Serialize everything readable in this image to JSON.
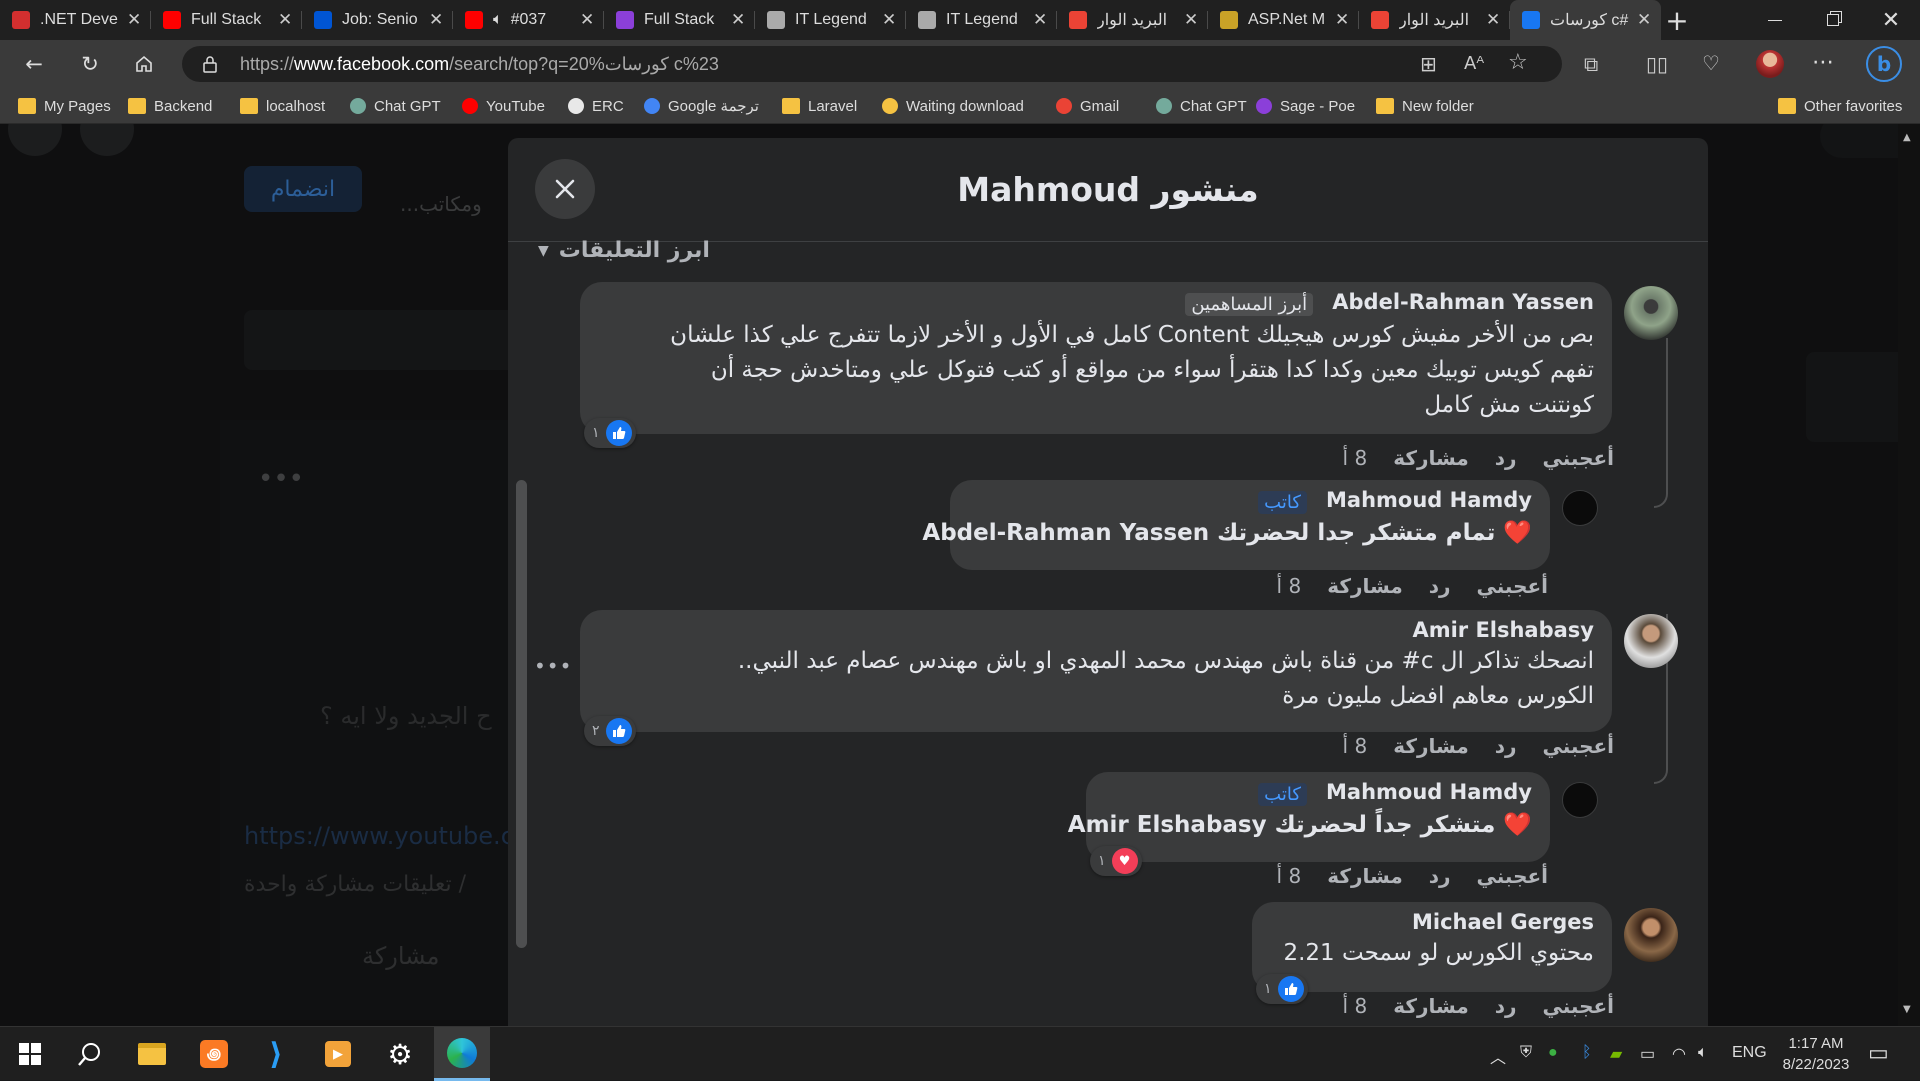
{
  "browser": {
    "tabs": [
      {
        "title": ".NET Deve",
        "icon": "pdf-icon",
        "color": "#d32f2f"
      },
      {
        "title": "Full Stack",
        "icon": "youtube-icon",
        "color": "#ff0000"
      },
      {
        "title": "Job: Senio",
        "icon": "wuzzuf-icon",
        "color": "#0055d4"
      },
      {
        "title": "#037",
        "icon": "youtube-icon",
        "color": "#ff0000",
        "audio": true
      },
      {
        "title": "Full Stack",
        "icon": "poe-icon",
        "color": "#8b3fd9"
      },
      {
        "title": "IT Legend",
        "icon": "page-icon",
        "color": "#aaaaaa"
      },
      {
        "title": "IT Legend",
        "icon": "page-icon",
        "color": "#aaaaaa"
      },
      {
        "title": "البريد الوار",
        "icon": "gmail-icon",
        "color": "#ea4335"
      },
      {
        "title": "ASP.Net M",
        "icon": "pin-icon",
        "color": "#c9a227"
      },
      {
        "title": "البريد الوار",
        "icon": "gmail-icon",
        "color": "#ea4335"
      },
      {
        "title": "كورسات c#",
        "icon": "facebook-icon",
        "color": "#1877f2",
        "active": true
      }
    ],
    "new_tab": "+",
    "url_prefix": "https://",
    "url_host": "www.facebook.com",
    "url_path": "/search/top?q=20%كورسات c%23",
    "bookmarks": [
      {
        "label": "My Pages",
        "icon": "folder-icon"
      },
      {
        "label": "Backend",
        "icon": "folder-icon"
      },
      {
        "label": "localhost",
        "icon": "folder-icon"
      },
      {
        "label": "Chat GPT",
        "icon": "chatgpt-icon"
      },
      {
        "label": "YouTube",
        "icon": "youtube-icon"
      },
      {
        "label": "ERC",
        "icon": "erc-icon"
      },
      {
        "label": "Google ترجمة",
        "icon": "translate-icon"
      },
      {
        "label": "Laravel",
        "icon": "folder-icon"
      },
      {
        "label": "Waiting download",
        "icon": "download-icon"
      },
      {
        "label": "Gmail",
        "icon": "gmail-icon"
      },
      {
        "label": "Chat GPT",
        "icon": "chatgpt-icon"
      },
      {
        "label": "Sage - Poe",
        "icon": "poe-icon"
      },
      {
        "label": "New folder",
        "icon": "folder-icon"
      }
    ],
    "other_favorites": "Other favorites"
  },
  "background_page": {
    "join_button": "انضمام",
    "snippet": "ومكاتب...",
    "question": "ح الجديد ولا ايه ؟",
    "link": "https://www.youtube.co",
    "stats": "/ تعليقات  مشاركة واحدة",
    "share": "مشاركة"
  },
  "modal": {
    "title": "منشور Mahmoud",
    "sort_label": "ابرز التعليقات",
    "comments": [
      {
        "author": "Abdel-Rahman Yassen",
        "badge": "أبرز المساهمين",
        "lines": [
          "بص من الأخر مفيش كورس هيجيلك Content كامل في الأول و الأخر لازما تتفرج علي كذا علشان",
          "تفهم كويس توبيك معين وكدا كدا هتقرأ سواء من مواقع أو كتب فتوكل علي ومتاخدش حجة أن",
          "كونتنت مش كامل"
        ],
        "reaction_count": "١",
        "like": "أعجبني",
        "reply": "رد",
        "share": "مشاركة",
        "time": "8 أ"
      },
      {
        "author": "Mahmoud Hamdy",
        "badge": "كاتب",
        "lines": [
          "❤️ تمام متشكر جدا لحضرتك Abdel-Rahman Yassen"
        ],
        "like": "أعجبني",
        "reply": "رد",
        "share": "مشاركة",
        "time": "8 أ"
      },
      {
        "author": "Amir Elshabasy",
        "lines": [
          "انصحك تذاكر ال c# من قناة باش مهندس محمد المهدي او باش مهندس عصام عبد النبي..",
          "الكورس معاهم افضل مليون مرة"
        ],
        "reaction_count": "٢",
        "like": "أعجبني",
        "reply": "رد",
        "share": "مشاركة",
        "time": "8 أ"
      },
      {
        "author": "Mahmoud Hamdy",
        "badge": "كاتب",
        "lines": [
          "❤️ متشكر جداً لحضرتك Amir Elshabasy"
        ],
        "reaction_count": "١",
        "like": "أعجبني",
        "reply": "رد",
        "share": "مشاركة",
        "time": "8 أ"
      },
      {
        "author": "Michael Gerges",
        "lines": [
          "محتوي الكورس لو سمحت 2.21"
        ],
        "reaction_count": "١",
        "like": "أعجبني",
        "reply": "رد",
        "share": "مشاركة",
        "time": "8 أ"
      }
    ]
  },
  "taskbar": {
    "language": "ENG",
    "time": "1:17 AM",
    "date": "8/22/2023"
  },
  "colors": {
    "facebook_blue": "#1877f2",
    "modal_bg": "#242526",
    "bubble_bg": "#3a3b3c",
    "author_badge": "#4599ff"
  }
}
